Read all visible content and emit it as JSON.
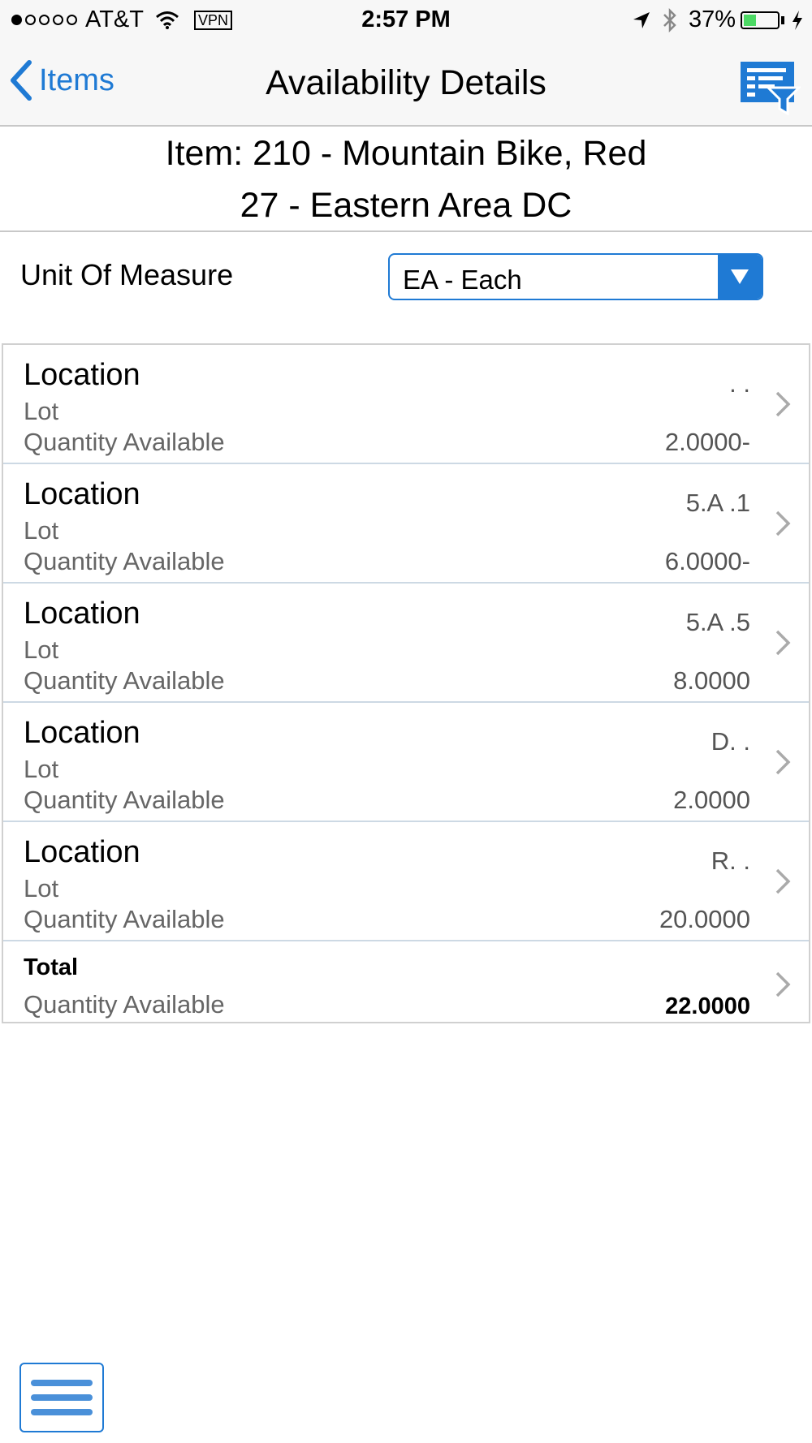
{
  "status": {
    "carrier": "AT&T",
    "vpn": "VPN",
    "time": "2:57 PM",
    "battery": "37%",
    "battery_level": 0.37
  },
  "nav": {
    "back_label": "Items",
    "title": "Availability Details",
    "filter_icon": "list-filter-icon"
  },
  "header": {
    "item": "Item: 210 - Mountain Bike, Red",
    "branch": "27 - Eastern Area DC"
  },
  "uom": {
    "label": "Unit Of Measure",
    "value": "EA - Each"
  },
  "rows": [
    {
      "location_label": "Location",
      "location": ". .",
      "lot_label": "Lot",
      "qty_label": "Quantity Available",
      "qty": "2.0000-"
    },
    {
      "location_label": "Location",
      "location": "5.A .1",
      "lot_label": "Lot",
      "qty_label": "Quantity Available",
      "qty": "6.0000-"
    },
    {
      "location_label": "Location",
      "location": "5.A .5",
      "lot_label": "Lot",
      "qty_label": "Quantity Available",
      "qty": "8.0000"
    },
    {
      "location_label": "Location",
      "location": "D. .",
      "lot_label": "Lot",
      "qty_label": "Quantity Available",
      "qty": "2.0000"
    },
    {
      "location_label": "Location",
      "location": "R. .",
      "lot_label": "Lot",
      "qty_label": "Quantity Available",
      "qty": "20.0000"
    }
  ],
  "total": {
    "label": "Total",
    "qty_label": "Quantity Available",
    "qty": "22.0000"
  },
  "colors": {
    "accent": "#1f7ad4",
    "bar_bg": "#f7f7f7",
    "battery": "#4cd964"
  }
}
